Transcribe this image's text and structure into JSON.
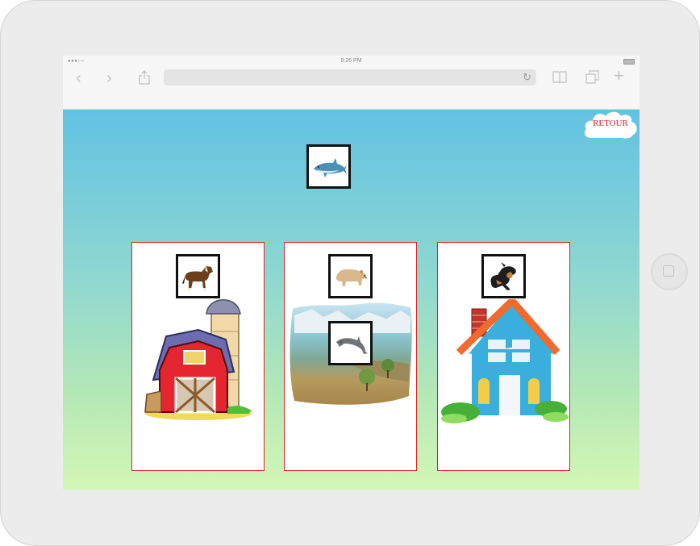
{
  "status_bar": {
    "time": "9:26 PM",
    "signal": "●●●○○"
  },
  "browser": {
    "back_label": "‹",
    "forward_label": "›",
    "add_tab_label": "+",
    "reload_label": "↻"
  },
  "page": {
    "retour_label": "RETOUR",
    "dragged_animal": "shark",
    "cards": [
      {
        "habitat": "farm",
        "animal": "horse"
      },
      {
        "habitat": "nature",
        "animals": [
          "bear",
          "dolphin"
        ]
      },
      {
        "habitat": "house",
        "animal": "dog"
      }
    ]
  },
  "colors": {
    "sky_top": "#62c2e2",
    "sky_bottom": "#d4f7b6",
    "card_border": "#dd2222",
    "retour_text": "#d0202a"
  }
}
